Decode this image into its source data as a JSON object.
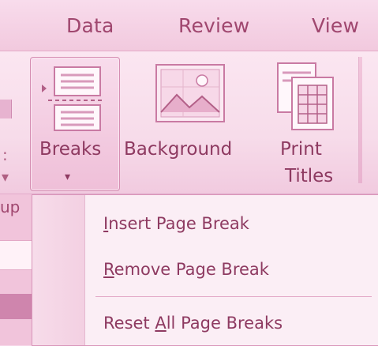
{
  "tabs": [
    "Data",
    "Review",
    "View"
  ],
  "ribbon": {
    "left_partial_caret": "▾",
    "left_partial_colon": ":",
    "breaks": {
      "label": "Breaks",
      "arrow": "▾"
    },
    "background": {
      "label": "Background"
    },
    "print_titles": {
      "label_line1": "Print",
      "label_line2": "Titles"
    },
    "group_label_partial": "up"
  },
  "menu": {
    "items": [
      {
        "before": "",
        "accel": "I",
        "after": "nsert Page Break"
      },
      {
        "before": "",
        "accel": "R",
        "after": "emove Page Break"
      },
      {
        "before": "Reset ",
        "accel": "A",
        "after": "ll Page Breaks"
      }
    ]
  },
  "icons": {
    "breaks": "page-breaks-icon",
    "background": "background-image-icon",
    "print_titles": "print-titles-icon"
  },
  "colors": {
    "tint": "#f6d6e8",
    "text": "#8e3a61",
    "accent": "#d58db2"
  }
}
